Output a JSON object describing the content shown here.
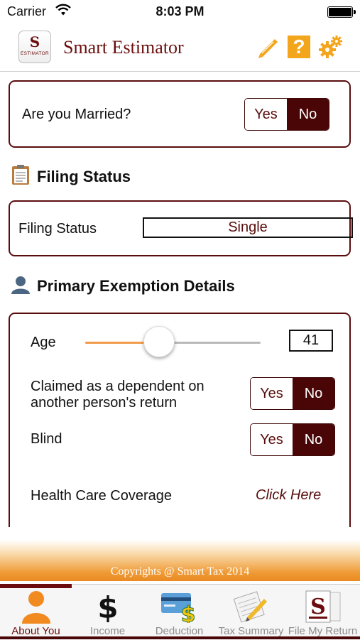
{
  "status_bar": {
    "carrier": "Carrier",
    "time": "8:03 PM"
  },
  "header": {
    "logo_letter": "S",
    "logo_caption": "ESTIMATOR",
    "title": "Smart Estimator",
    "help_label": "?"
  },
  "married": {
    "question": "Are you Married?",
    "yes": "Yes",
    "no": "No",
    "selected": "No"
  },
  "filing": {
    "section_title": "Filing Status",
    "label": "Filing Status",
    "value": "Single"
  },
  "exemption": {
    "section_title": "Primary Exemption Details",
    "age_label": "Age",
    "age_value": "41",
    "age_slider_fraction": 0.42,
    "dependent_label_line1": "Claimed as a dependent on",
    "dependent_label_line2": "another person's return",
    "dependent_yes": "Yes",
    "dependent_no": "No",
    "dependent_selected": "No",
    "blind_label": "Blind",
    "blind_yes": "Yes",
    "blind_no": "No",
    "blind_selected": "No",
    "health_label": "Health Care Coverage",
    "health_link": "Click Here"
  },
  "footer": {
    "copyright": "Copyrights @ Smart Tax 2014"
  },
  "tabs": [
    {
      "label": "About You",
      "icon": "person-icon",
      "active": true
    },
    {
      "label": "Income",
      "icon": "dollar-icon",
      "active": false
    },
    {
      "label": "Deduction",
      "icon": "card-dollar-icon",
      "active": false
    },
    {
      "label": "Tax Summary",
      "icon": "notepad-pencil-icon",
      "active": false
    },
    {
      "label": "File My Return",
      "icon": "file-return-icon",
      "active": false
    }
  ],
  "colors": {
    "brand": "#6b0d0d",
    "accent": "#f3a51b",
    "selected_segment": "#4a0606",
    "footer_orange": "#ea8a22"
  }
}
